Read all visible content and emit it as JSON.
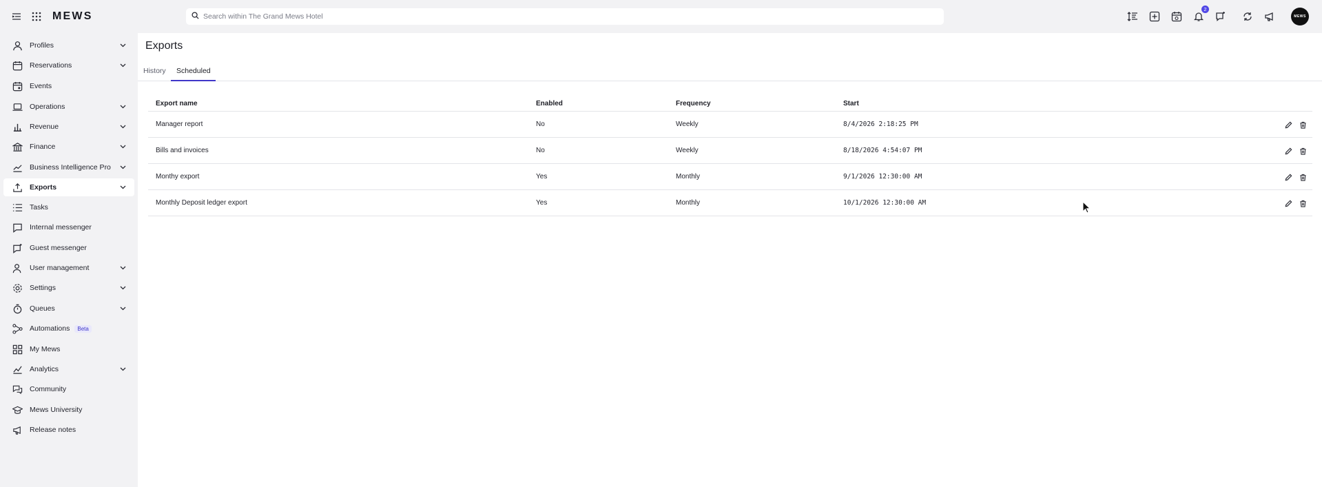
{
  "app": {
    "logo": "MEWS",
    "search_placeholder": "Search within The Grand Mews Hotel",
    "notification_count": "2",
    "avatar_text": "MEWS"
  },
  "sidebar": {
    "items": [
      {
        "label": "Profiles",
        "icon": "person-icon",
        "chevron": true
      },
      {
        "label": "Reservations",
        "icon": "calendar-icon",
        "chevron": true
      },
      {
        "label": "Events",
        "icon": "calendar-event-icon",
        "chevron": false
      },
      {
        "label": "Operations",
        "icon": "laptop-icon",
        "chevron": true
      },
      {
        "label": "Revenue",
        "icon": "bar-chart-icon",
        "chevron": true
      },
      {
        "label": "Finance",
        "icon": "bank-icon",
        "chevron": true
      },
      {
        "label": "Business Intelligence Pro",
        "icon": "line-chart-icon",
        "chevron": true
      },
      {
        "label": "Exports",
        "icon": "upload-icon",
        "chevron": true,
        "active": true
      },
      {
        "label": "Tasks",
        "icon": "list-icon",
        "chevron": false
      },
      {
        "label": "Internal messenger",
        "icon": "chat-icon",
        "chevron": false
      },
      {
        "label": "Guest messenger",
        "icon": "guest-chat-icon",
        "chevron": false
      },
      {
        "label": "User management",
        "icon": "user-manage-icon",
        "chevron": true
      },
      {
        "label": "Settings",
        "icon": "gear-icon",
        "chevron": true
      },
      {
        "label": "Queues",
        "icon": "stopwatch-icon",
        "chevron": true
      },
      {
        "label": "Automations",
        "icon": "automation-icon",
        "chevron": false,
        "badge": "Beta"
      },
      {
        "label": "My Mews",
        "icon": "grid-icon",
        "chevron": false
      },
      {
        "label": "Analytics",
        "icon": "analytics-icon",
        "chevron": true
      },
      {
        "label": "Community",
        "icon": "community-icon",
        "chevron": false
      },
      {
        "label": "Mews University",
        "icon": "graduation-cap-icon",
        "chevron": false
      },
      {
        "label": "Release notes",
        "icon": "megaphone-icon",
        "chevron": false
      }
    ]
  },
  "main": {
    "title": "Exports",
    "tabs": [
      {
        "label": "History",
        "active": false
      },
      {
        "label": "Scheduled",
        "active": true
      }
    ],
    "table": {
      "columns": [
        "Export name",
        "Enabled",
        "Frequency",
        "Start"
      ],
      "rows": [
        {
          "name": "Manager report",
          "enabled": "No",
          "frequency": "Weekly",
          "start": "8/4/2026 2:18:25 PM"
        },
        {
          "name": "Bills and invoices",
          "enabled": "No",
          "frequency": "Weekly",
          "start": "8/18/2026 4:54:07 PM"
        },
        {
          "name": "Monthy export",
          "enabled": "Yes",
          "frequency": "Monthly",
          "start": "9/1/2026 12:30:00 AM"
        },
        {
          "name": "Monthly Deposit ledger export",
          "enabled": "Yes",
          "frequency": "Monthly",
          "start": "10/1/2026 12:30:00 AM"
        }
      ]
    }
  },
  "colors": {
    "accent": "#3f37c9",
    "sidebar_bg": "#f2f2f4",
    "badge": "#5147e6"
  }
}
